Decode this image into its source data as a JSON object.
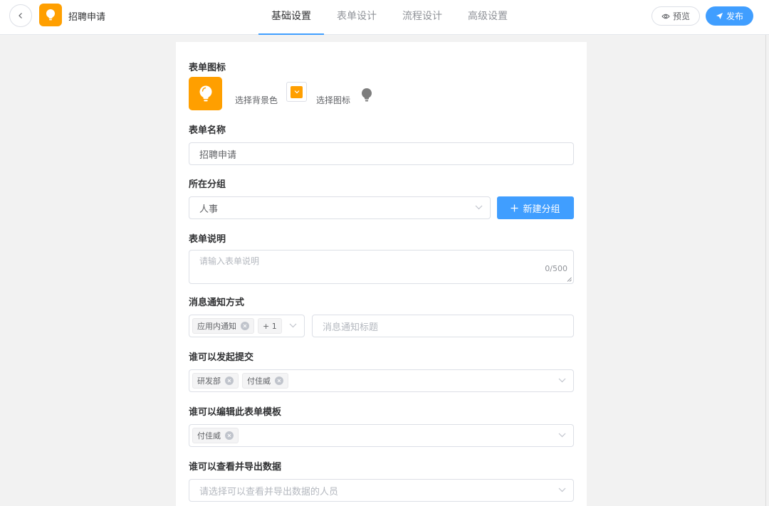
{
  "header": {
    "app_title": "招聘申请",
    "tabs": [
      {
        "label": "基础设置",
        "active": true
      },
      {
        "label": "表单设计",
        "active": false
      },
      {
        "label": "流程设计",
        "active": false
      },
      {
        "label": "高级设置",
        "active": false
      }
    ],
    "preview_label": "预览",
    "publish_label": "发布"
  },
  "colors": {
    "accent": "#409eff",
    "icon_bg": "#ff9f00"
  },
  "form": {
    "icon": {
      "label": "表单图标",
      "select_bg_label": "选择背景色",
      "select_icon_label": "选择图标",
      "icon_name": "lightbulb-icon"
    },
    "name": {
      "label": "表单名称",
      "value": "招聘申请"
    },
    "group": {
      "label": "所在分组",
      "value": "人事",
      "new_group_label": "新建分组"
    },
    "description": {
      "label": "表单说明",
      "placeholder": "请输入表单说明",
      "counter": "0/500"
    },
    "notify": {
      "label": "消息通知方式",
      "tags": [
        "应用内通知"
      ],
      "more": "+ 1",
      "title_placeholder": "消息通知标题"
    },
    "submitters": {
      "label": "谁可以发起提交",
      "tags": [
        "研发部",
        "付佳威"
      ]
    },
    "editors": {
      "label": "谁可以编辑此表单模板",
      "tags": [
        "付佳威"
      ]
    },
    "viewers": {
      "label": "谁可以查看并导出数据",
      "placeholder": "请选择可以查看并导出数据的人员"
    }
  }
}
